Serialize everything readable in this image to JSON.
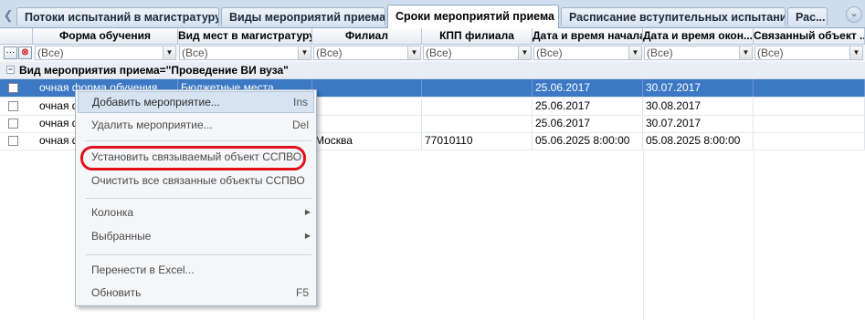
{
  "tabs": [
    {
      "label": "Потоки испытаний в магистратуру",
      "active": false
    },
    {
      "label": "Виды мероприятий приема",
      "active": false
    },
    {
      "label": "Сроки мероприятий приема",
      "active": true
    },
    {
      "label": "Расписание вступительных испытаний",
      "active": false
    },
    {
      "label": "Рас...",
      "active": false
    }
  ],
  "grid": {
    "columns": [
      "Форма обучения",
      "Вид мест в магистратуру",
      "Филиал",
      "КПП филиала",
      "Дата и время начала",
      "Дата и время окон...",
      "Связанный объект ..."
    ],
    "filter_value": "(Все)",
    "filter_tool_icons": [
      "ellipsis-icon",
      "clear-filter-icon"
    ],
    "group_label": "Вид мероприятия приема=\"Проведение ВИ вуза\"",
    "rows": [
      {
        "form": "очная форма обучения",
        "place": "Бюджетные места",
        "filial": "",
        "kpp": "",
        "start": "25.06.2017",
        "end": "30.07.2017",
        "linked": "",
        "selected": true
      },
      {
        "form": "очная ф",
        "place": "",
        "filial": "",
        "kpp": "",
        "start": "25.06.2017",
        "end": "30.08.2017",
        "linked": "",
        "selected": false
      },
      {
        "form": "очная ф",
        "place": "",
        "filial": "",
        "kpp": "",
        "start": "25.06.2017",
        "end": "30.07.2017",
        "linked": "",
        "selected": false
      },
      {
        "form": "очная ф",
        "place": "",
        "filial": "Москва",
        "kpp": "77010110",
        "start": "05.06.2025 8:00:00",
        "end": "05.08.2025 8:00:00",
        "linked": "",
        "selected": false
      }
    ]
  },
  "context_menu": {
    "items": [
      {
        "label": "Добавить мероприятие...",
        "shortcut": "Ins",
        "highlighted": true
      },
      {
        "label": "Удалить мероприятие...",
        "shortcut": "Del"
      },
      {
        "label": "Установить связываемый объект ССПВО",
        "shortcut": ""
      },
      {
        "label": "Очистить все связанные объекты ССПВО",
        "shortcut": ""
      },
      {
        "label": "Колонка",
        "shortcut": "",
        "submenu": true
      },
      {
        "label": "Выбранные",
        "shortcut": "",
        "submenu": true
      },
      {
        "label": "Перенести в Excel...",
        "shortcut": ""
      },
      {
        "label": "Обновить",
        "shortcut": "F5"
      }
    ]
  },
  "colors": {
    "selection": "#3c78c4",
    "annotation": "#e0121b",
    "tab_strip": "#cfdcec"
  }
}
